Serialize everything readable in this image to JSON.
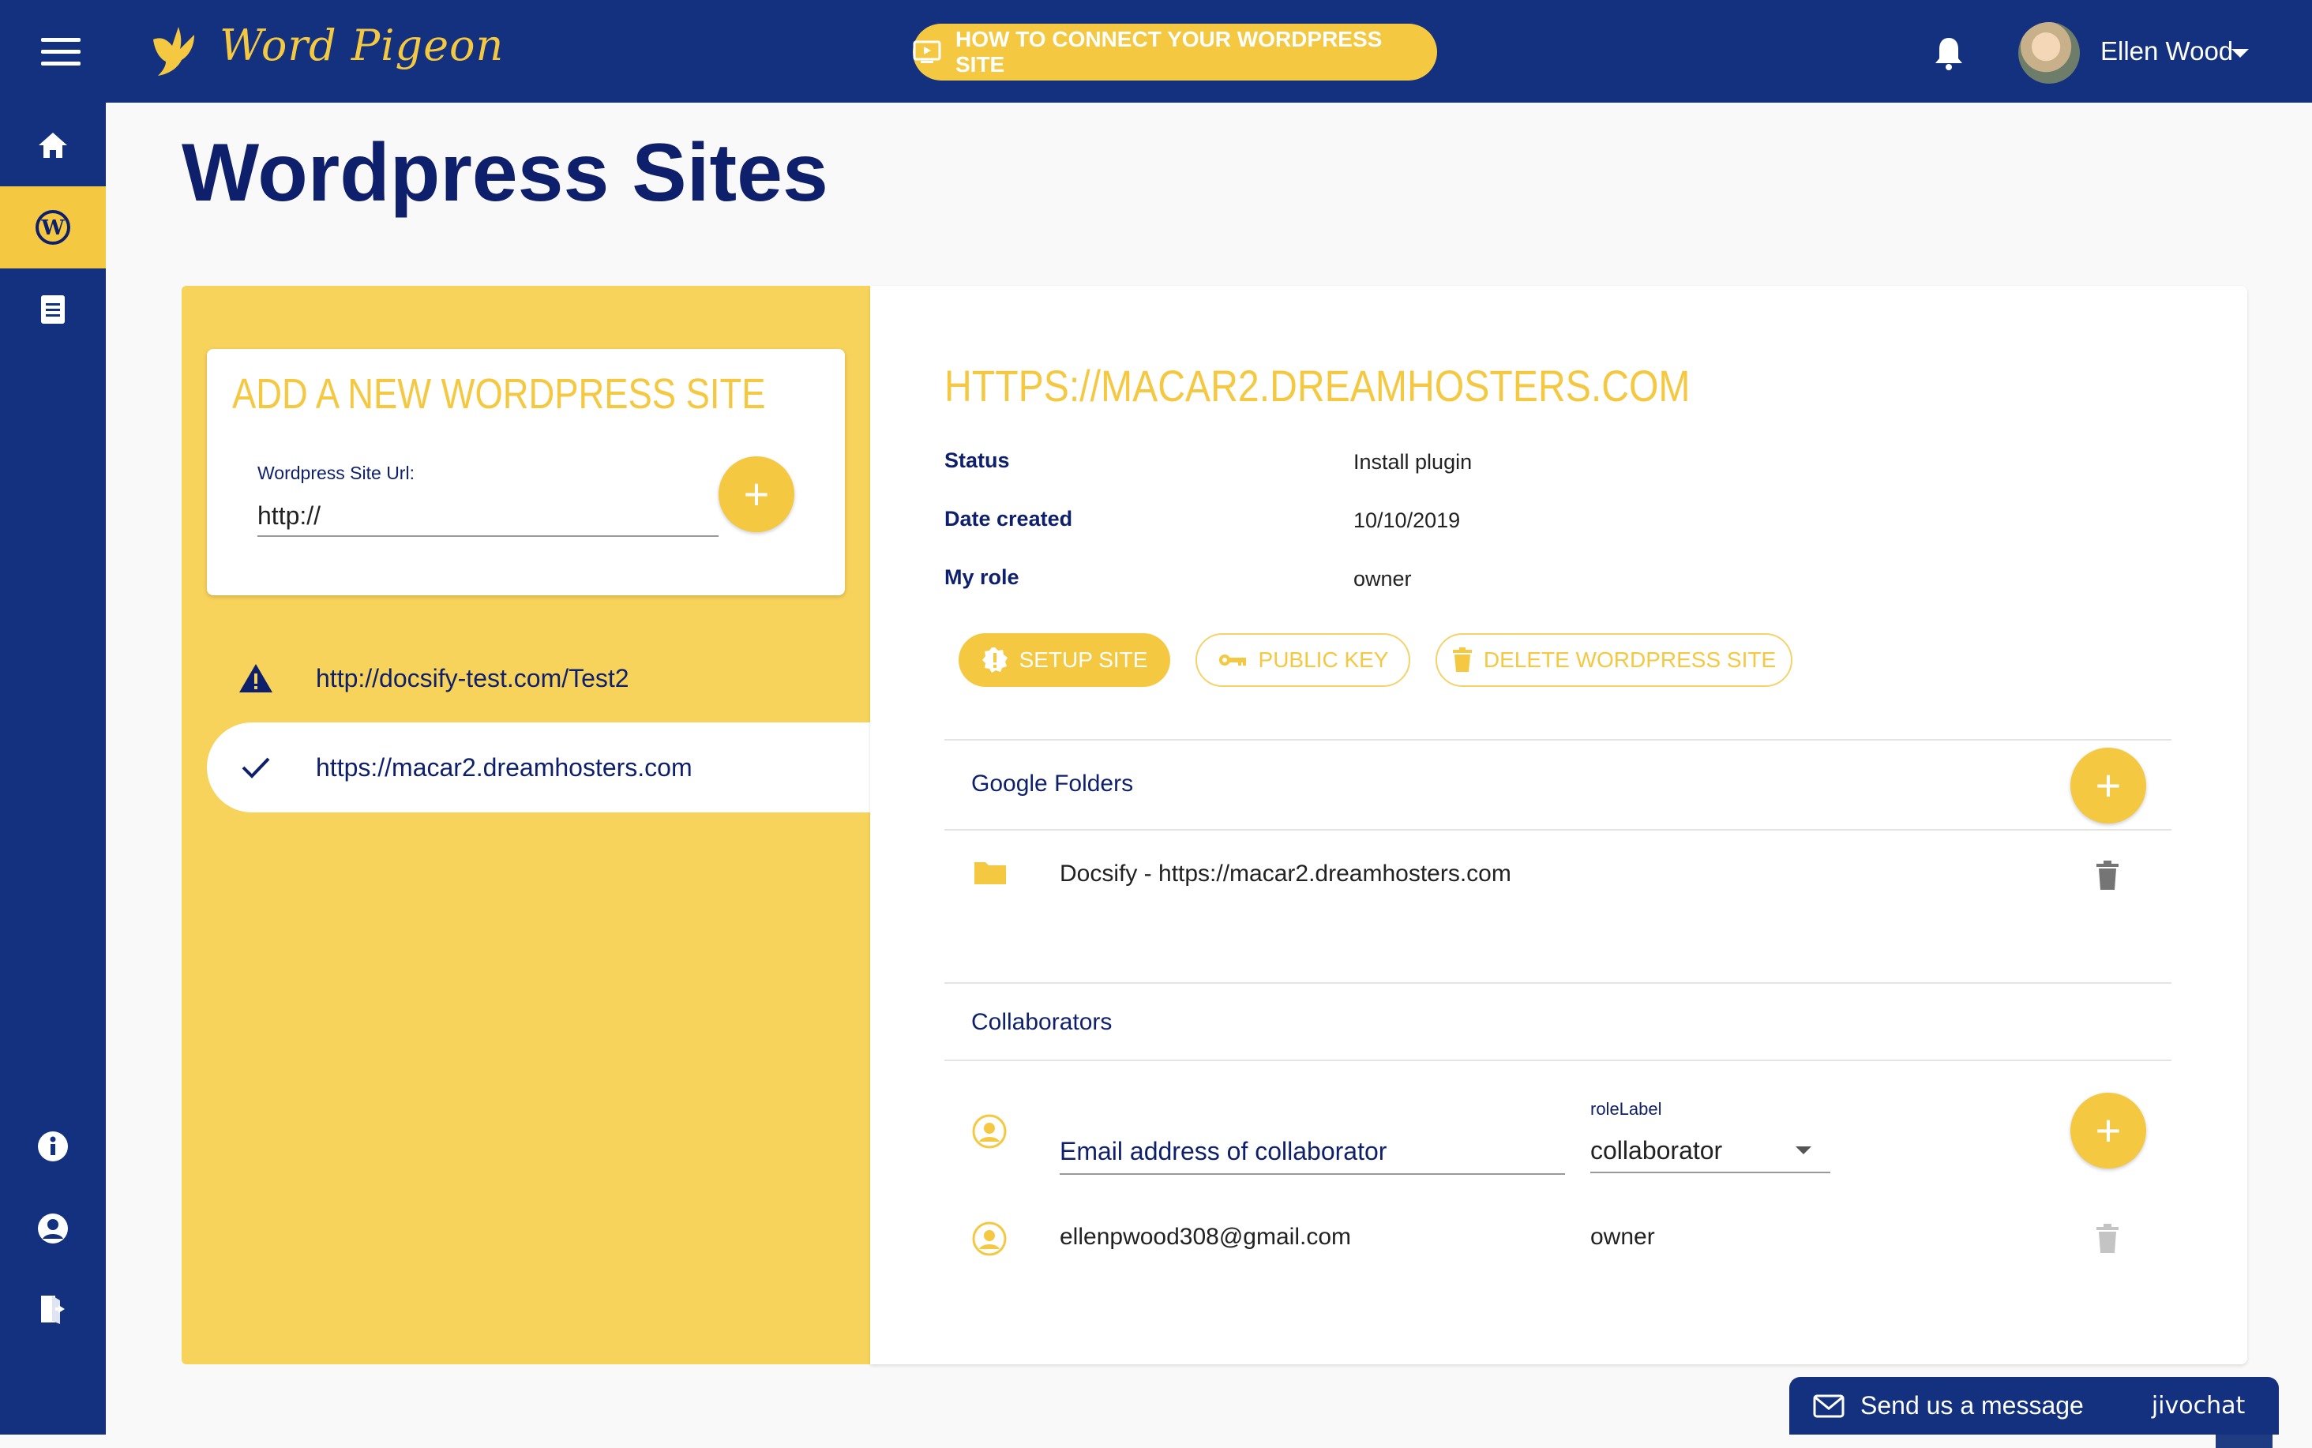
{
  "app": {
    "logo_text": "Word Pigeon",
    "how_to_button": "HOW TO CONNECT YOUR WORDPRESS SITE",
    "user_name": "Ellen Wood"
  },
  "page": {
    "title": "Wordpress Sites"
  },
  "add_site": {
    "title": "ADD A NEW WORDPRESS SITE",
    "url_label": "Wordpress Site Url:",
    "url_value": "http://"
  },
  "sites": [
    {
      "url": "http://docsify-test.com/Test2",
      "status_icon": "warning-icon"
    },
    {
      "url": "https://macar2.dreamhosters.com",
      "status_icon": "check-icon"
    }
  ],
  "detail": {
    "title": "HTTPS://MACAR2.DREAMHOSTERS.COM",
    "fields": [
      {
        "label": "Status",
        "value": "Install plugin"
      },
      {
        "label": "Date created",
        "value": "10/10/2019"
      },
      {
        "label": "My role",
        "value": "owner"
      }
    ],
    "buttons": {
      "setup": "SETUP SITE",
      "public_key": "PUBLIC KEY",
      "delete": "DELETE WORDPRESS SITE"
    },
    "google_folders": {
      "title": "Google Folders",
      "items": [
        "Docsify - https://macar2.dreamhosters.com"
      ]
    },
    "collaborators": {
      "title": "Collaborators",
      "email_placeholder": "Email address of collaborator",
      "role_label": "roleLabel",
      "role_value": "collaborator",
      "items": [
        {
          "email": "ellenpwood308@gmail.com",
          "role": "owner"
        }
      ]
    }
  },
  "chat": {
    "label": "Send us a message",
    "brand": "jivochat"
  },
  "colors": {
    "primary": "#13317f",
    "accent": "#f5c842",
    "panel": "#f8d35b"
  }
}
